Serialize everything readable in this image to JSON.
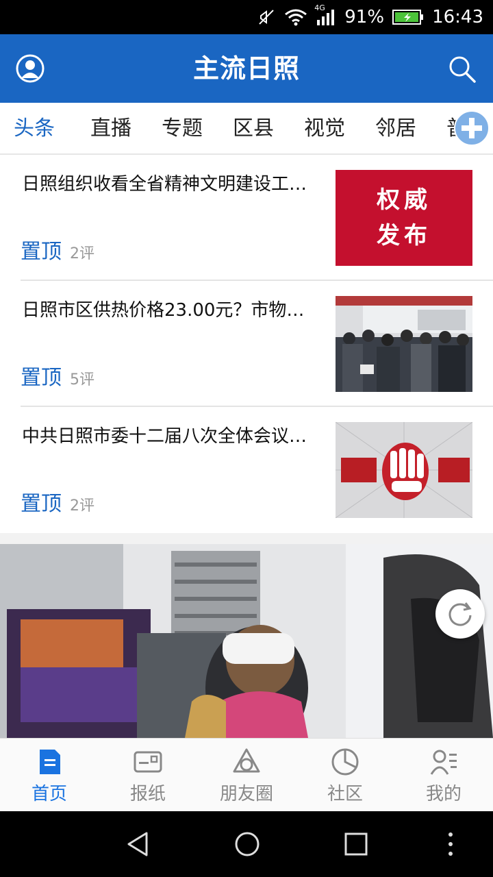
{
  "status": {
    "signal": "4G",
    "battery": "91%",
    "time": "16:43"
  },
  "header": {
    "title": "主流日照"
  },
  "tabs": [
    {
      "label": "头条",
      "active": true
    },
    {
      "label": "直播"
    },
    {
      "label": "专题"
    },
    {
      "label": "区县"
    },
    {
      "label": "视觉"
    },
    {
      "label": "邻居"
    },
    {
      "label": "普"
    }
  ],
  "news": [
    {
      "title": "日照组织收看全省精神文明建设工…",
      "pin": "置顶",
      "comments": "2评",
      "thumb_text": [
        "权威",
        "发布"
      ]
    },
    {
      "title": "日照市区供热价格23.00元？市物…",
      "pin": "置顶",
      "comments": "5评"
    },
    {
      "title": "中共日照市委十二届八次全体会议…",
      "pin": "置顶",
      "comments": "2评"
    }
  ],
  "bottom_nav": [
    {
      "label": "首页",
      "active": true,
      "icon": "home-doc-icon"
    },
    {
      "label": "报纸",
      "icon": "newspaper-icon"
    },
    {
      "label": "朋友圈",
      "icon": "friends-circle-icon"
    },
    {
      "label": "社区",
      "icon": "community-pie-icon"
    },
    {
      "label": "我的",
      "icon": "profile-list-icon"
    }
  ],
  "colors": {
    "brand_blue": "#1a66c2",
    "accent_red": "#c4102e"
  }
}
